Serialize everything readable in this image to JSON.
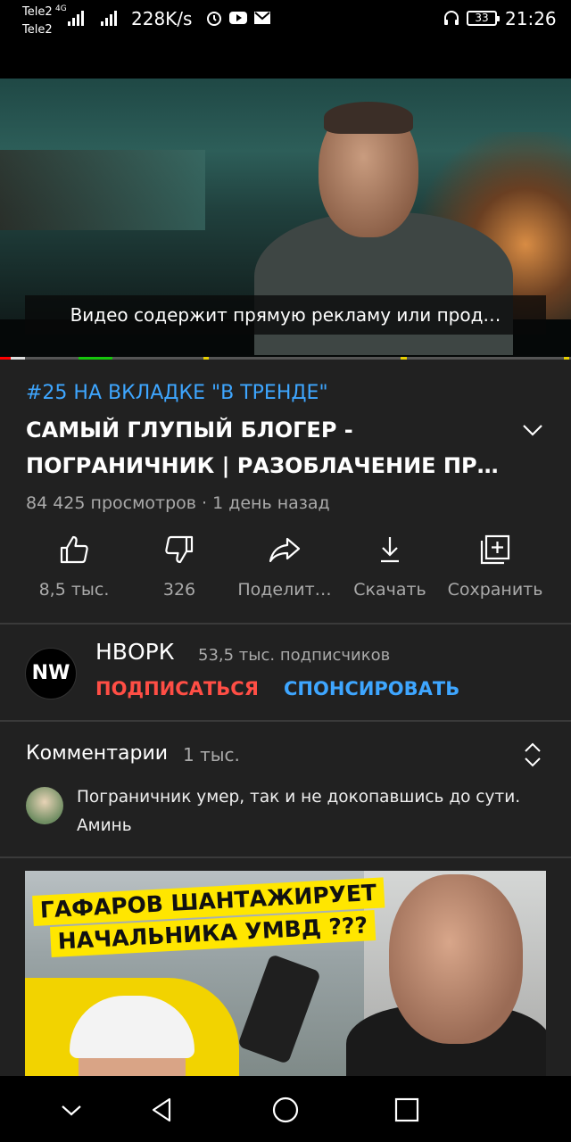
{
  "status_bar": {
    "carrier_1": "Tele2",
    "carrier_2": "Tele2",
    "network_type": "4G",
    "speed": "228K/s",
    "battery": "33",
    "time": "21:26",
    "icons": [
      "signal-icon",
      "signal-icon",
      "alarm-icon",
      "youtube-icon",
      "mail-icon",
      "headphones-icon",
      "battery-icon"
    ]
  },
  "player": {
    "subtitle": "Видео содержит прямую рекламу или прод…"
  },
  "video": {
    "hashtag": "#25 НА ВКЛАДКЕ \"В ТРЕНДЕ\"",
    "title": "САМЫЙ ГЛУПЫЙ БЛОГЕР - ПОГРАНИЧНИК | РАЗОБЛАЧЕНИЕ ПР…",
    "meta": "84 425 просмотров · 1 день назад"
  },
  "actions": {
    "like": "8,5 тыс.",
    "dislike": "326",
    "share": "Поделит…",
    "download": "Скачать",
    "save": "Сохранить"
  },
  "channel": {
    "avatar_text": "NW",
    "name": "НВОРК",
    "subscribers": "53,5 тыс. подписчиков",
    "subscribe": "ПОДПИСАТЬСЯ",
    "sponsor": "СПОНСИРОВАТЬ"
  },
  "comments": {
    "title": "Комментарии",
    "count": "1 тыс.",
    "top_comment": "Пограничник умер, так и не докопавшись до сути. Аминь"
  },
  "next_video": {
    "thumb_line_1": "ГАФАРОВ ШАНТАЖИРУЕТ",
    "thumb_line_2": "НАЧАЛЬНИКА УМВД ???"
  },
  "colors": {
    "background": "#212121",
    "link_blue": "#3ea6ff",
    "subscribe_red": "#ff4e45",
    "secondary_text": "#aaaaaa"
  }
}
